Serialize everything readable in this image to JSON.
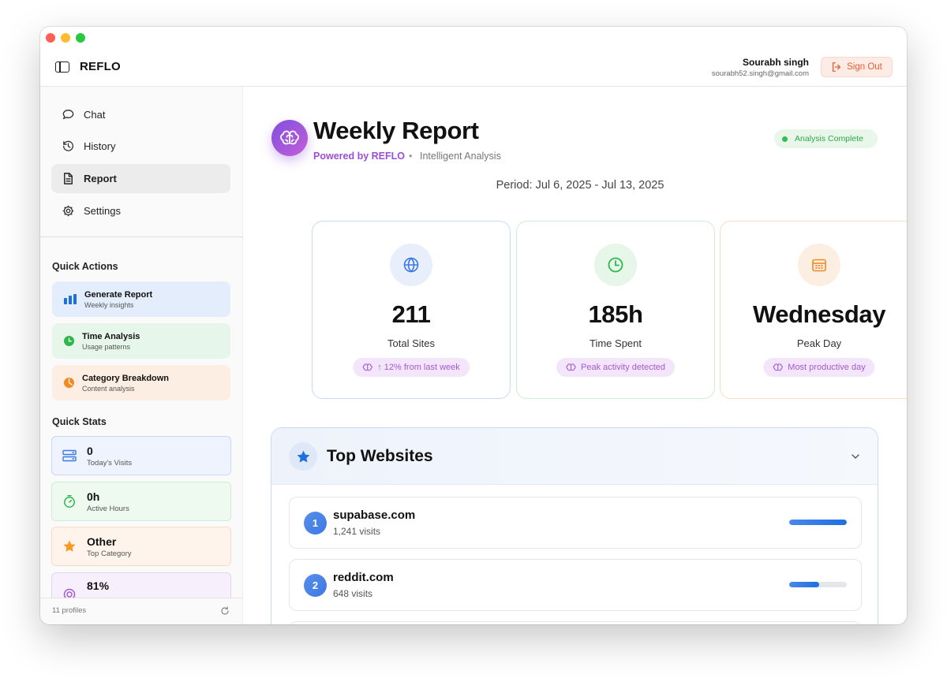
{
  "header": {
    "brand": "REFLO",
    "user_name": "Sourabh singh",
    "user_email": "sourabh52.singh@gmail.com",
    "signout_label": "Sign Out"
  },
  "sidebar": {
    "nav": [
      {
        "label": "Chat",
        "icon": "chat-bubble-icon",
        "active": false
      },
      {
        "label": "History",
        "icon": "history-clock-icon",
        "active": false
      },
      {
        "label": "Report",
        "icon": "document-icon",
        "active": true
      },
      {
        "label": "Settings",
        "icon": "gear-icon",
        "active": false
      }
    ],
    "quick_actions_title": "Quick Actions",
    "quick_actions": [
      {
        "title": "Generate Report",
        "subtitle": "Weekly insights",
        "icon": "bar-chart-icon",
        "color": "#1d6fe0",
        "bg": "#e3edfc"
      },
      {
        "title": "Time Analysis",
        "subtitle": "Usage patterns",
        "icon": "clock-icon",
        "color": "#2db84d",
        "bg": "#e7f6ea"
      },
      {
        "title": "Category Breakdown",
        "subtitle": "Content analysis",
        "icon": "pie-icon",
        "color": "#f08a24",
        "bg": "#fdeee3"
      }
    ],
    "quick_stats_title": "Quick Stats",
    "quick_stats": [
      {
        "value": "0",
        "label": "Today's Visits",
        "icon": "visits-icon",
        "color": "#3b78e7",
        "bg": "#eef3fd",
        "border": "#c8d9f6"
      },
      {
        "value": "0h",
        "label": "Active Hours",
        "icon": "timer-icon",
        "color": "#2db84d",
        "bg": "#eef9f0",
        "border": "#cdebd3"
      },
      {
        "value": "Other",
        "label": "Top Category",
        "icon": "star-icon",
        "color": "#f59a23",
        "bg": "#fef4ec",
        "border": "#f6dcc6"
      },
      {
        "value": "81%",
        "label": "",
        "icon": "target-icon",
        "color": "#a35ad0",
        "bg": "#f7effc",
        "border": "#e6d3f3"
      }
    ],
    "footer_profiles": "11 profiles"
  },
  "report": {
    "title": "Weekly Report",
    "powered_by": "Powered by REFLO",
    "separator": "•",
    "subtitle": "Intelligent Analysis",
    "status": "Analysis Complete",
    "period": "Period: Jul 6, 2025 - Jul 13, 2025"
  },
  "stats": [
    {
      "value": "211",
      "label": "Total Sites",
      "chip": "↑ 12% from last week",
      "icon": "globe-icon",
      "accent": "#3b78e7",
      "circle_bg": "#e8effb",
      "border": "#c8d9f6"
    },
    {
      "value": "185h",
      "label": "Time Spent",
      "chip": "Peak activity detected",
      "icon": "clock-icon",
      "accent": "#2db84d",
      "circle_bg": "#e6f6e9",
      "border": "#cbeed2"
    },
    {
      "value": "Wednesday",
      "label": "Peak Day",
      "chip": "Most productive day",
      "icon": "calendar-icon",
      "accent": "#f08a24",
      "circle_bg": "#fdeee2",
      "border": "#f8dcc4"
    }
  ],
  "top_websites": {
    "title": "Top Websites",
    "sites": [
      {
        "rank": "1",
        "name": "supabase.com",
        "visits": "1,241 visits",
        "share": 1.0
      },
      {
        "rank": "2",
        "name": "reddit.com",
        "visits": "648 visits",
        "share": 0.52
      }
    ]
  }
}
